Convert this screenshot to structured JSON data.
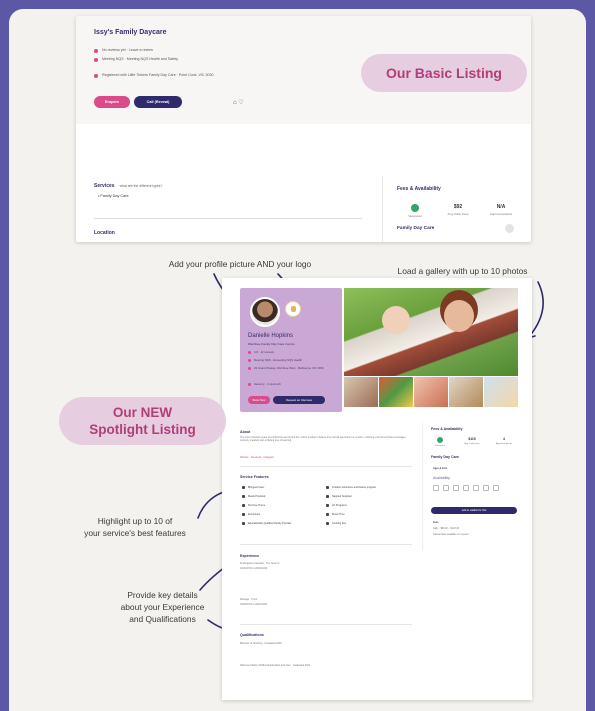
{
  "basic_listing": {
    "title": "Issy's Family Daycare",
    "lines": [
      "No reviews yet · Leave a review",
      "Meeting NQS · Meeting NQS Health and Safety",
      "Registered with Little Tinkers Family Day Care · Point Cook, VIC 3030"
    ],
    "enquire_label": "Enquire",
    "call_label": "Call (Reveal)",
    "services_label": "Services",
    "services_hint": "· what are the different types?",
    "service_item": "• Family Day Care",
    "location_label": "Location",
    "fees_title": "Fees & Availability",
    "fees": [
      {
        "value": "",
        "label": "Vacancies"
      },
      {
        "value": "$92",
        "label": "Avg. Daily Fees"
      },
      {
        "value": "N/A",
        "label": "Approved places"
      }
    ],
    "fdc_label": "Family Day Care",
    "badge": "Our Basic Listing"
  },
  "annotations": {
    "profile_logo": "Add your profile picture AND your logo",
    "gallery": "Load a gallery with up to 10 photos",
    "features": [
      "Highlight up to 10 of",
      "your service's best features"
    ],
    "experience": [
      "Provide key details",
      "about your Experience",
      "and Qualifications"
    ]
  },
  "spotlight": {
    "badge_line1": "Our NEW",
    "badge_line2": "Spotlight Listing",
    "name": "Danielle Hopkins",
    "subtitle": "Werribee Family Day Care Centre",
    "lines": [
      "4.8 · 12 reviews",
      "Meeting NQS · Exceeding NQS Health",
      "23 Grand Parade, Werribee West · Melbourne VIC 3030",
      "Vacancy · 2 spots left"
    ],
    "book_label": "Book Now",
    "request_label": "Request an Interview",
    "about_title": "About",
    "about_text": "The most important years of a child's life are the first five, which is where I believe they should spend them in a warm, nurturing environment that encourages curiosity, creativity and a lifelong love of learning.",
    "links": "Website · Facebook · Instagram",
    "features_title": "Service Features",
    "features": [
      "Bilingual Carer",
      "Outdoor Adventure and Nature program",
      "Meals Provided",
      "Nappies Supplied",
      "Pet-Free Home",
      "Art Programs",
      "Excursions",
      "Music Time",
      "Educationally Qualified Family Provider",
      "Cooking Fun"
    ],
    "experience_title": "Experience",
    "experience_entries": [
      "Kindergarten Assistant · The Nest Inc",
      "2016/07/01 to 2019/01/01",
      "Manager · Point",
      "2019/07/01 to 2021/01/01"
    ],
    "qualifications_title": "Qualifications",
    "qualification_entries": [
      "Bachelor of Teaching · Graduated 2020",
      "Diploma of Early Childhood Education and Care · Graduated 2021"
    ],
    "side_fees_title": "Fees & Availability",
    "side_fees": [
      {
        "value": "",
        "label": "Vacancies"
      },
      {
        "value": "$115",
        "label": "Avg. Daily Fees"
      },
      {
        "value": "4",
        "label": "Approved places"
      }
    ],
    "side_fdc": "Family Day Care",
    "ages_label": "Ages & Cost",
    "availability_label": "Availability",
    "days": [
      "M",
      "T",
      "W",
      "T",
      "F",
      "S",
      "S"
    ],
    "waitlist_label": "Add to waitlist for this",
    "fees_label": "Fees",
    "fee_rows": [
      "Daily · $96.00 – $123.00",
      "Casual rates available on request"
    ]
  },
  "colors": {
    "background": "#5b58a6",
    "panel": "#f3f2ee",
    "badge_bg": "#e6cde0",
    "badge_text": "#b03e79",
    "navy": "#2f2a6b",
    "pink": "#d94b8b",
    "profile_bg": "#c9a8d6"
  }
}
